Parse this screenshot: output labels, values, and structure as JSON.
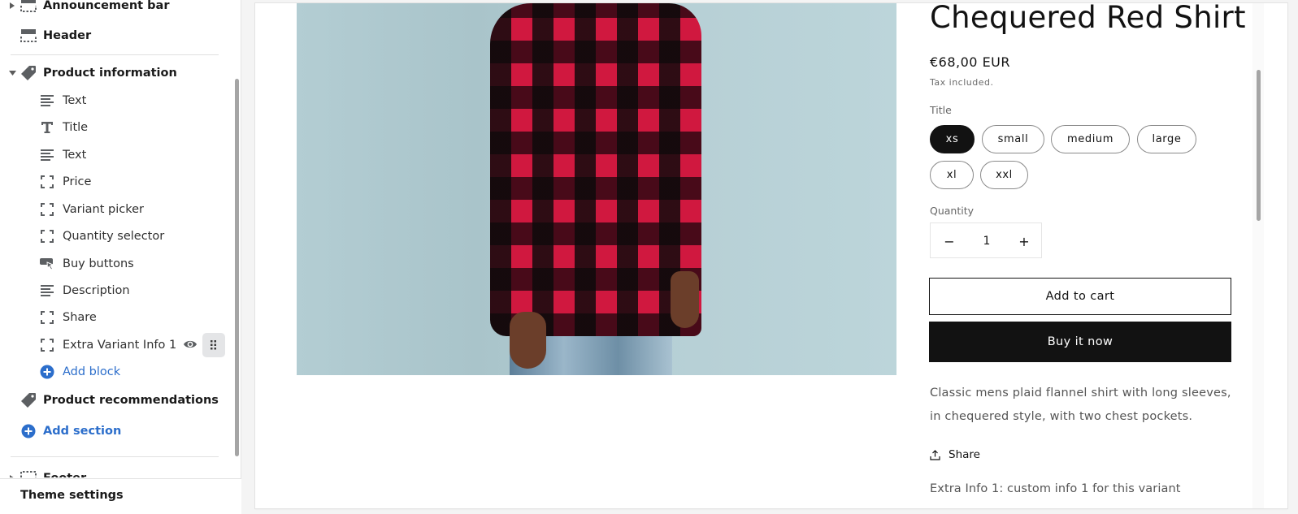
{
  "sidebar": {
    "sections": {
      "announcement_bar": "Announcement bar",
      "header": "Header",
      "product_information": "Product information",
      "product_recommendations": "Product recommendations",
      "footer": "Footer"
    },
    "blocks": [
      {
        "label": "Text",
        "icon": "text-lines-icon"
      },
      {
        "label": "Title",
        "icon": "title-T-icon"
      },
      {
        "label": "Text",
        "icon": "text-lines-icon"
      },
      {
        "label": "Price",
        "icon": "dashed-frame-icon"
      },
      {
        "label": "Variant picker",
        "icon": "dashed-frame-icon"
      },
      {
        "label": "Quantity selector",
        "icon": "dashed-frame-icon"
      },
      {
        "label": "Buy buttons",
        "icon": "buy-button-cursor-icon"
      },
      {
        "label": "Description",
        "icon": "text-lines-icon"
      },
      {
        "label": "Share",
        "icon": "dashed-frame-icon"
      },
      {
        "label": "Extra Variant Info 1",
        "icon": "dashed-frame-icon"
      }
    ],
    "add_block": "Add block",
    "add_section": "Add section",
    "theme_settings": "Theme settings"
  },
  "product": {
    "title": "Chequered Red Shirt",
    "price": "€68,00 EUR",
    "tax_note": "Tax included.",
    "option_label": "Title",
    "variants": [
      "xs",
      "small",
      "medium",
      "large",
      "xl",
      "xxl"
    ],
    "selected_variant": "xs",
    "quantity_label": "Quantity",
    "quantity": "1",
    "decrease": "−",
    "increase": "+",
    "add_to_cart": "Add to cart",
    "buy_now": "Buy it now",
    "description": "Classic mens plaid flannel shirt with long sleeves, in chequered style, with two chest pockets.",
    "share": "Share",
    "extra_info": "Extra Info 1: custom info 1 for this variant"
  },
  "colors": {
    "accent_link": "#2c6ecb",
    "button_dark": "#121212",
    "selected_pill": "#121212"
  }
}
